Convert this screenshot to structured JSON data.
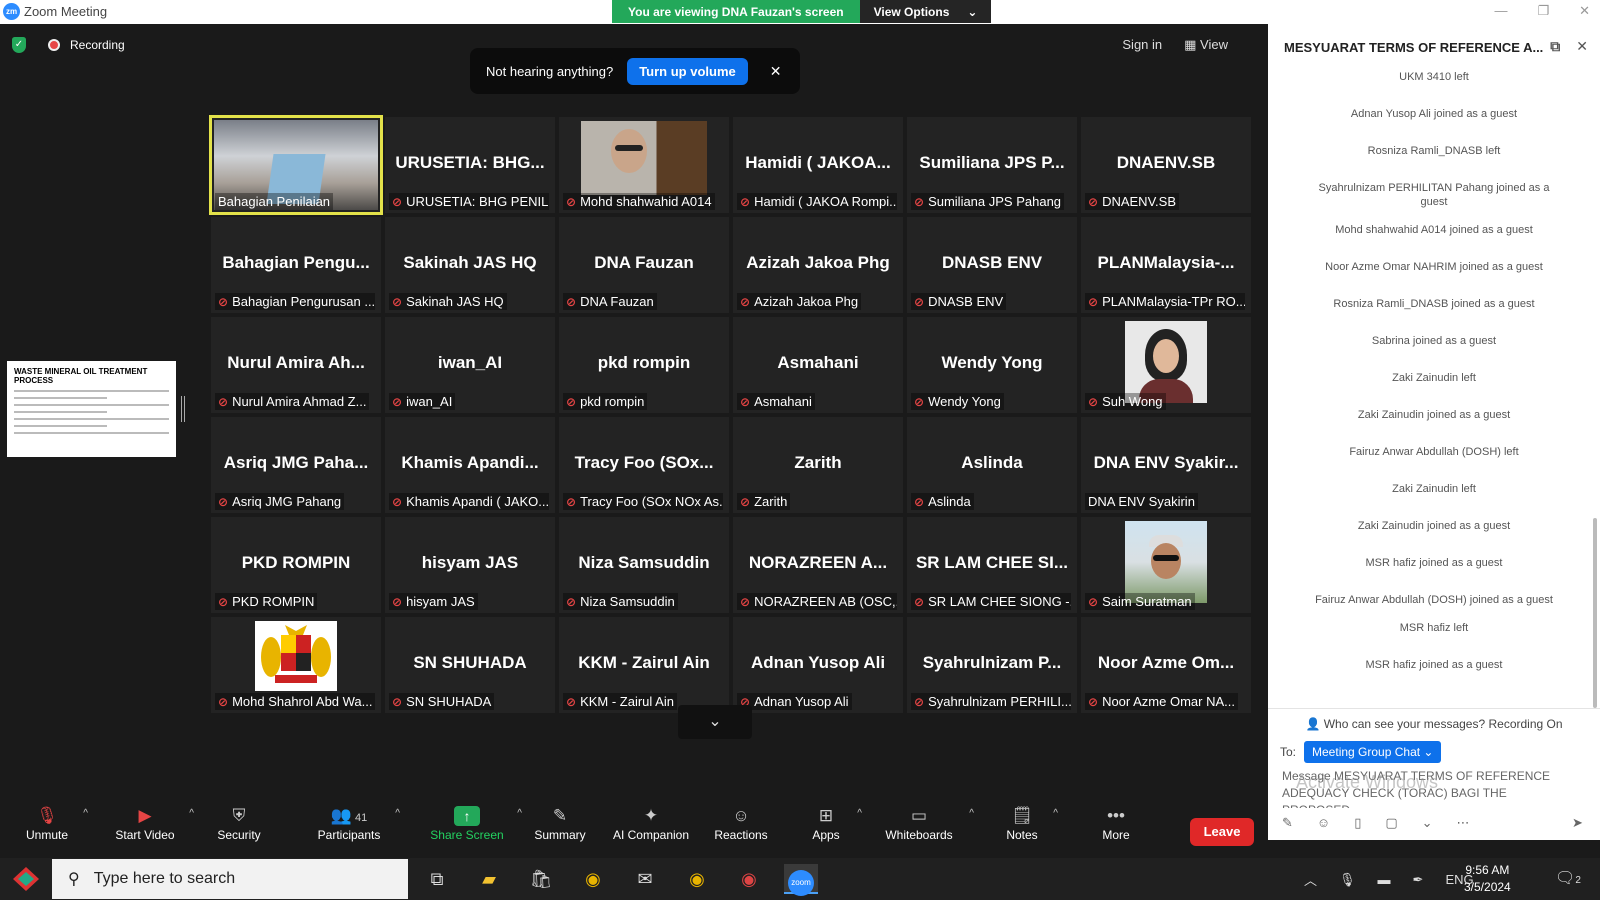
{
  "window": {
    "title": "Zoom Meeting",
    "logo": "zm",
    "share_banner": "You are viewing DNA Fauzan's screen",
    "view_options": "View Options",
    "controls": [
      "minimize-icon",
      "maximize-icon",
      "close-icon"
    ]
  },
  "meeting": {
    "recording_label": "Recording",
    "sign_in": "Sign in",
    "view_label": "View",
    "toast_text": "Not hearing anything?",
    "toast_button": "Turn up volume"
  },
  "shared_doc": {
    "title": "WASTE MINERAL OIL TREATMENT PROCESS"
  },
  "participants": [
    {
      "big": "",
      "label": "Bahagian Penilaian",
      "photo": "room",
      "muted": false,
      "active": true
    },
    {
      "big": "URUSETIA: BHG...",
      "label": "URUSETIA: BHG PENIL...",
      "muted": true
    },
    {
      "big": "",
      "label": "Mohd shahwahid A014",
      "photo": "man",
      "muted": true
    },
    {
      "big": "Hamidi ( JAKOA...",
      "label": "Hamidi ( JAKOA Rompi...",
      "muted": true
    },
    {
      "big": "Sumiliana JPS P...",
      "label": "Sumiliana JPS Pahang",
      "muted": true
    },
    {
      "big": "DNAENV.SB",
      "label": "DNAENV.SB",
      "muted": true
    },
    {
      "big": "Bahagian Pengu...",
      "label": "Bahagian Pengurusan ...",
      "muted": true
    },
    {
      "big": "Sakinah JAS HQ",
      "label": "Sakinah JAS HQ",
      "muted": true
    },
    {
      "big": "DNA Fauzan",
      "label": "DNA Fauzan",
      "muted": true
    },
    {
      "big": "Azizah Jakoa Phg",
      "label": "Azizah Jakoa Phg",
      "muted": true
    },
    {
      "big": "DNASB ENV",
      "label": "DNASB ENV",
      "muted": true
    },
    {
      "big": "PLANMalaysia-...",
      "label": "PLANMalaysia-TPr RO...",
      "muted": true
    },
    {
      "big": "Nurul Amira Ah...",
      "label": "Nurul Amira Ahmad Z...",
      "muted": true
    },
    {
      "big": "iwan_AI",
      "label": "iwan_AI",
      "muted": true
    },
    {
      "big": "pkd rompin",
      "label": "pkd rompin",
      "muted": true
    },
    {
      "big": "Asmahani",
      "label": "Asmahani",
      "muted": true
    },
    {
      "big": "Wendy Yong",
      "label": "Wendy Yong",
      "muted": true
    },
    {
      "big": "",
      "label": "Suh Wong",
      "photo": "woman",
      "muted": true
    },
    {
      "big": "Asriq JMG Paha...",
      "label": "Asriq JMG Pahang",
      "muted": true
    },
    {
      "big": "Khamis Apandi...",
      "label": "Khamis Apandi ( JAKO...",
      "muted": true
    },
    {
      "big": "Tracy Foo (SOx...",
      "label": "Tracy Foo (SOx NOx As...",
      "muted": true
    },
    {
      "big": "Zarith",
      "label": "Zarith",
      "muted": true
    },
    {
      "big": "Aslinda",
      "label": "Aslinda",
      "muted": true
    },
    {
      "big": "DNA ENV Syakir...",
      "label": "DNA ENV Syakirin",
      "muted": false
    },
    {
      "big": "PKD ROMPIN",
      "label": "PKD ROMPIN",
      "muted": true
    },
    {
      "big": "hisyam JAS",
      "label": "hisyam JAS",
      "muted": true
    },
    {
      "big": "Niza Samsuddin",
      "label": "Niza Samsuddin",
      "muted": true
    },
    {
      "big": "NORAZREEN A...",
      "label": "NORAZREEN AB (OSC,...",
      "muted": true
    },
    {
      "big": "SR LAM CHEE SI...",
      "label": "SR LAM CHEE SIONG -...",
      "muted": true
    },
    {
      "big": "",
      "label": "Saim Suratman",
      "photo": "outdoor",
      "muted": true
    },
    {
      "big": "",
      "label": "Mohd Shahrol Abd Wa...",
      "photo": "crest",
      "muted": true
    },
    {
      "big": "SN SHUHADA",
      "label": "SN SHUHADA",
      "muted": true
    },
    {
      "big": "KKM - Zairul Ain",
      "label": "KKM - Zairul Ain",
      "muted": true
    },
    {
      "big": "Adnan Yusop Ali",
      "label": "Adnan Yusop Ali",
      "muted": true
    },
    {
      "big": "Syahrulnizam P...",
      "label": "Syahrulnizam PERHILI...",
      "muted": true
    },
    {
      "big": "Noor Azme Om...",
      "label": "Noor Azme Omar NA...",
      "muted": true
    }
  ],
  "toolbar": {
    "unmute": "Unmute",
    "start_video": "Start Video",
    "security": "Security",
    "participants": "Participants",
    "participants_count": "41",
    "share_screen": "Share Screen",
    "summary": "Summary",
    "ai_companion": "AI Companion",
    "reactions": "Reactions",
    "apps": "Apps",
    "whiteboards": "Whiteboards",
    "notes": "Notes",
    "more": "More",
    "leave": "Leave"
  },
  "chat": {
    "title": "MESYUARAT TERMS OF REFERENCE A...",
    "messages": [
      "UKM 3410 left",
      "Adnan Yusop Ali joined as a guest",
      "Rosniza Ramli_DNASB left",
      "Syahrulnizam PERHILITAN Pahang joined as a guest",
      "Mohd shahwahid A014 joined as a guest",
      "Noor Azme Omar NAHRIM joined as a guest",
      "Rosniza Ramli_DNASB joined as a guest",
      "Sabrina joined as a guest",
      "Zaki Zainudin left",
      "Zaki Zainudin joined as a guest",
      "Fairuz Anwar Abdullah (DOSH) left",
      "Zaki Zainudin left",
      "Zaki Zainudin joined as a guest",
      "MSR hafiz joined as a guest",
      "Fairuz Anwar Abdullah (DOSH) joined as a guest",
      "MSR hafiz left",
      "MSR hafiz joined as a guest"
    ],
    "who_can_see": "Who can see your messages? Recording On",
    "to_label": "To:",
    "recipient": "Meeting Group Chat",
    "input_value": "Message MESYUARAT TERMS OF REFERENCE ADEQUACY CHECK (TORAC) BAGI THE PROPOSED...",
    "watermark": "Activate Windows"
  },
  "taskbar": {
    "search_placeholder": "Type here to search",
    "language": "ENG",
    "time": "9:56 AM",
    "date": "3/5/2024",
    "notifications": "2"
  },
  "colors": {
    "accent_blue": "#0e71eb",
    "share_green": "#23a85a",
    "leave_red": "#e02828",
    "active_speaker": "#e3e24a"
  }
}
